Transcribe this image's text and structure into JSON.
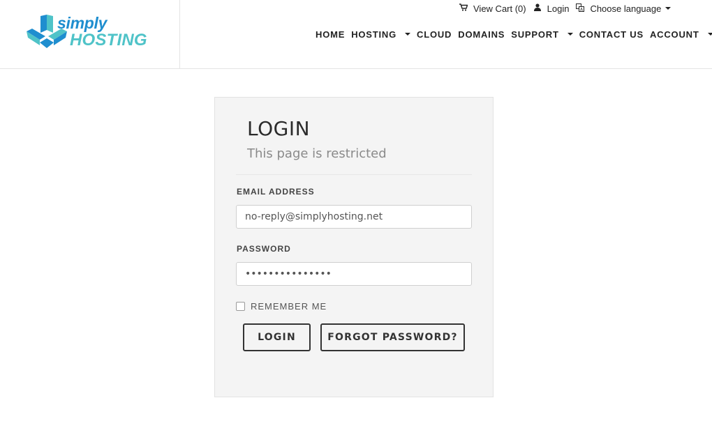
{
  "brand": {
    "line1": "simply",
    "line2": "HOSTING",
    "colors": {
      "primary": "#1f8ecf",
      "secondary": "#4fc3c8"
    }
  },
  "topbar": {
    "cart": {
      "icon": "cart-icon",
      "label": "View Cart (0)"
    },
    "login": {
      "icon": "user-icon",
      "label": "Login"
    },
    "language": {
      "icon": "translate-icon",
      "label": "Choose language"
    }
  },
  "nav": {
    "items": [
      {
        "label": "HOME",
        "dropdown": false
      },
      {
        "label": "HOSTING",
        "dropdown": true
      },
      {
        "label": "CLOUD",
        "dropdown": false
      },
      {
        "label": "DOMAINS",
        "dropdown": false
      },
      {
        "label": "SUPPORT",
        "dropdown": true
      },
      {
        "label": "CONTACT US",
        "dropdown": false
      },
      {
        "label": "ACCOUNT",
        "dropdown": true
      }
    ]
  },
  "login": {
    "title": "LOGIN",
    "subtitle": "This page is restricted",
    "email_label": "EMAIL ADDRESS",
    "email_value": "no-reply@simplyhosting.net",
    "password_label": "PASSWORD",
    "password_value": "•••••••••••••••",
    "remember_label": "REMEMBER ME",
    "remember_checked": false,
    "login_button": "LOGIN",
    "forgot_button": "FORGOT PASSWORD?"
  }
}
